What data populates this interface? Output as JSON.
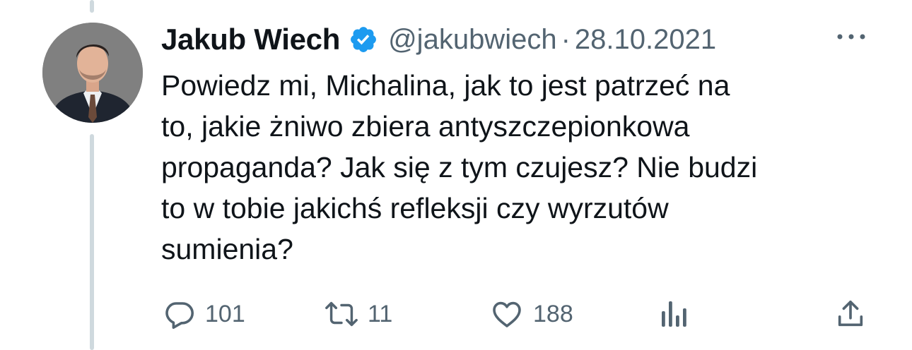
{
  "tweet": {
    "author": {
      "display_name": "Jakub Wiech",
      "handle": "@jakubwiech",
      "verified": true
    },
    "separator": "·",
    "date": "28.10.2021",
    "text_lines": [
      "Powiedz mi, Michalina, jak to jest patrzeć na",
      "to, jakie żniwo zbiera antyszczepionkowa",
      "propaganda? Jak się z tym czujesz? Nie budzi",
      "to w tobie jakichś refleksji czy wyrzutów",
      "sumienia?"
    ],
    "stats": {
      "replies": "101",
      "retweets": "11",
      "likes": "188"
    }
  },
  "colors": {
    "text": "#0f1419",
    "secondary": "#536471",
    "verified": "#1d9bf0",
    "thread_line": "#cfd9de"
  },
  "icons": [
    "verified-badge-icon",
    "more-icon",
    "reply-icon",
    "retweet-icon",
    "like-icon",
    "views-icon",
    "share-icon"
  ]
}
